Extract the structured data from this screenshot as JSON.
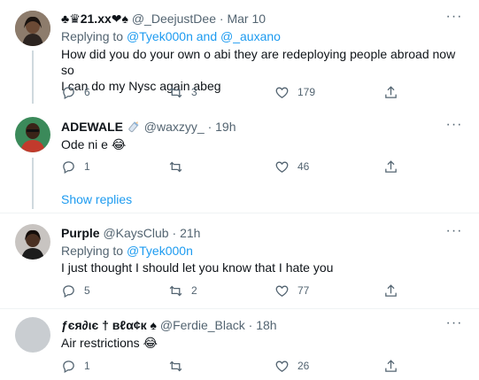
{
  "tweets": [
    {
      "name": "♣♛21.xx❤♠",
      "handle": "@_DeejustDee",
      "sep": "·",
      "time": "Mar 10",
      "replying_prefix": "Replying to",
      "replying_users": [
        "@Tyek000n",
        "and",
        "@_auxano"
      ],
      "text_lines": [
        "How did you do your own o abi they are redeploying people abroad now so",
        "I can do my Nysc again abeg"
      ],
      "replies": "6",
      "retweets": "3",
      "likes": "179"
    },
    {
      "name": "ADEWALE",
      "handle": "@waxzyy_",
      "sep": "·",
      "time": "19h",
      "text_lines": [
        "Ode ni e 😂"
      ],
      "replies": "1",
      "retweets": "",
      "likes": "46"
    },
    {
      "name": "Purple",
      "handle": "@KaysClub",
      "sep": "·",
      "time": "21h",
      "replying_prefix": "Replying to",
      "replying_users": [
        "@Tyek000n"
      ],
      "text_lines": [
        "I just thought I should let you know that I hate you"
      ],
      "replies": "5",
      "retweets": "2",
      "likes": "77"
    },
    {
      "name": "ƒєя∂ιє † вℓα¢к ♠",
      "handle": "@Ferdie_Black",
      "sep": "·",
      "time": "18h",
      "text_lines": [
        "Air restrictions 😂"
      ],
      "replies": "1",
      "retweets": "",
      "likes": "26"
    }
  ],
  "show_replies_label": "Show replies",
  "more_label": "···",
  "icons": {
    "reply": "reply-icon",
    "retweet": "retweet-icon",
    "like": "heart-icon",
    "share": "share-icon",
    "more": "more-options-icon",
    "badge": "baby-bottle-icon"
  },
  "colors": {
    "link": "#1d9bf0",
    "muted": "#536471",
    "text": "#0f1419"
  }
}
